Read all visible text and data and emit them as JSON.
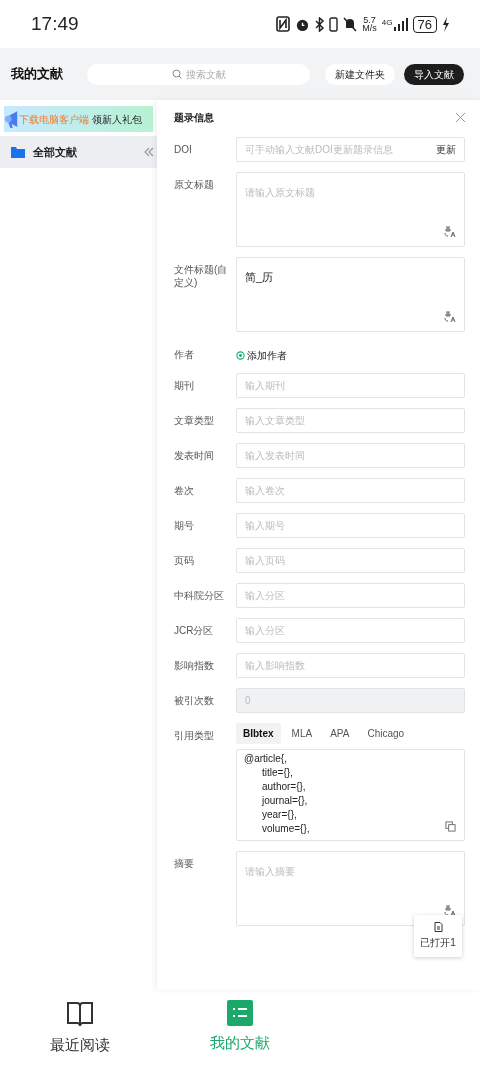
{
  "status_bar": {
    "time": "17:49",
    "speed": "5.7",
    "speed_unit": "M/s",
    "network": "4G",
    "battery": "76"
  },
  "header": {
    "title": "我的文献",
    "search": {
      "placeholder": "搜索文献"
    },
    "buttons": [
      {
        "label": "新建文件夹",
        "primary": false
      },
      {
        "label": "导入文献",
        "primary": true
      }
    ]
  },
  "sidebar": {
    "promo": {
      "highlight": "下载电脑客户端",
      "text": "领新人礼包"
    },
    "items": [
      {
        "label": "全部文献",
        "selected": true
      }
    ]
  },
  "panel": {
    "title": "题录信息",
    "fields": [
      {
        "kind": "input",
        "label": "DOI",
        "placeholder": "可手动输入文献DOI更新题录信息",
        "action": "更新"
      },
      {
        "kind": "textarea",
        "label": "原文标题",
        "placeholder": "请输入原文标题"
      },
      {
        "kind": "textarea",
        "label": "文件标题(自定义)",
        "value": "简_历"
      },
      {
        "kind": "add",
        "label": "作者",
        "action": "添加作者"
      },
      {
        "kind": "input",
        "label": "期刊",
        "placeholder": "输入期刊"
      },
      {
        "kind": "input",
        "label": "文章类型",
        "placeholder": "输入文章类型"
      },
      {
        "kind": "input",
        "label": "发表时间",
        "placeholder": "输入发表时间"
      },
      {
        "kind": "input",
        "label": "卷次",
        "placeholder": "输入卷次"
      },
      {
        "kind": "input",
        "label": "期号",
        "placeholder": "输入期号"
      },
      {
        "kind": "input",
        "label": "页码",
        "placeholder": "输入页码"
      },
      {
        "kind": "input",
        "label": "中科院分区",
        "placeholder": "输入分区"
      },
      {
        "kind": "input",
        "label": "JCR分区",
        "placeholder": "输入分区"
      },
      {
        "kind": "input",
        "label": "影响指数",
        "placeholder": "输入影响指数"
      },
      {
        "kind": "input",
        "label": "被引次数",
        "placeholder": "0",
        "disabled": true
      },
      {
        "kind": "citation",
        "label": "引用类型",
        "tabs": [
          {
            "label": "BIbtex",
            "selected": true
          },
          {
            "label": "MLA",
            "selected": false
          },
          {
            "label": "APA",
            "selected": false
          },
          {
            "label": "Chicago",
            "selected": false
          }
        ],
        "lines": [
          "@article{,",
          "title={},",
          "author={},",
          "journal={},",
          "year={},",
          "volume={},"
        ]
      },
      {
        "kind": "textarea",
        "label": "摘要",
        "placeholder": "请输入摘要"
      }
    ],
    "opened": "已打开1"
  },
  "bottom_nav": [
    {
      "label": "最近阅读",
      "selected": false
    },
    {
      "label": "我的文献",
      "selected": true
    }
  ]
}
